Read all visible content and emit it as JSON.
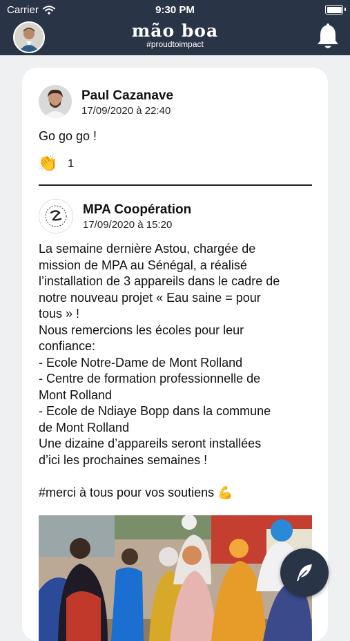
{
  "status_bar": {
    "carrier": "Carrier",
    "time": "9:30 PM"
  },
  "header": {
    "app_name": "mão boa",
    "tagline": "#proudtoimpact",
    "bell_icon": "bell-icon"
  },
  "comment": {
    "author": "Paul Cazanave",
    "date": "17/09/2020 à 22:40",
    "text": "Go go go !",
    "reaction_emoji": "👏",
    "reaction_count": "1"
  },
  "post": {
    "author": "MPA Coopération",
    "date": "17/09/2020 à 15:20",
    "body": "La semaine dernière Astou, chargée de\nmission de MPA au Sénégal, a réalisé\nl’installation de 3 appareils dans le cadre de\nnotre nouveau projet « Eau saine = pour\ntous » !\nNous remercions les écoles pour leur\nconfiance:\n- Ecole Notre-Dame de Mont Rolland\n- Centre de formation professionnelle de\nMont Rolland\n- Ecole de Ndiaye Bopp dans la commune\nde Mont Rolland\nUne dizaine d’appareils seront installées\nd’ici les prochaines semaines !\n\n#merci à tous pour vos soutiens 💪"
  },
  "colors": {
    "header_bg": "#2a3447",
    "page_bg": "#eef0f2",
    "card_bg": "#ffffff"
  }
}
